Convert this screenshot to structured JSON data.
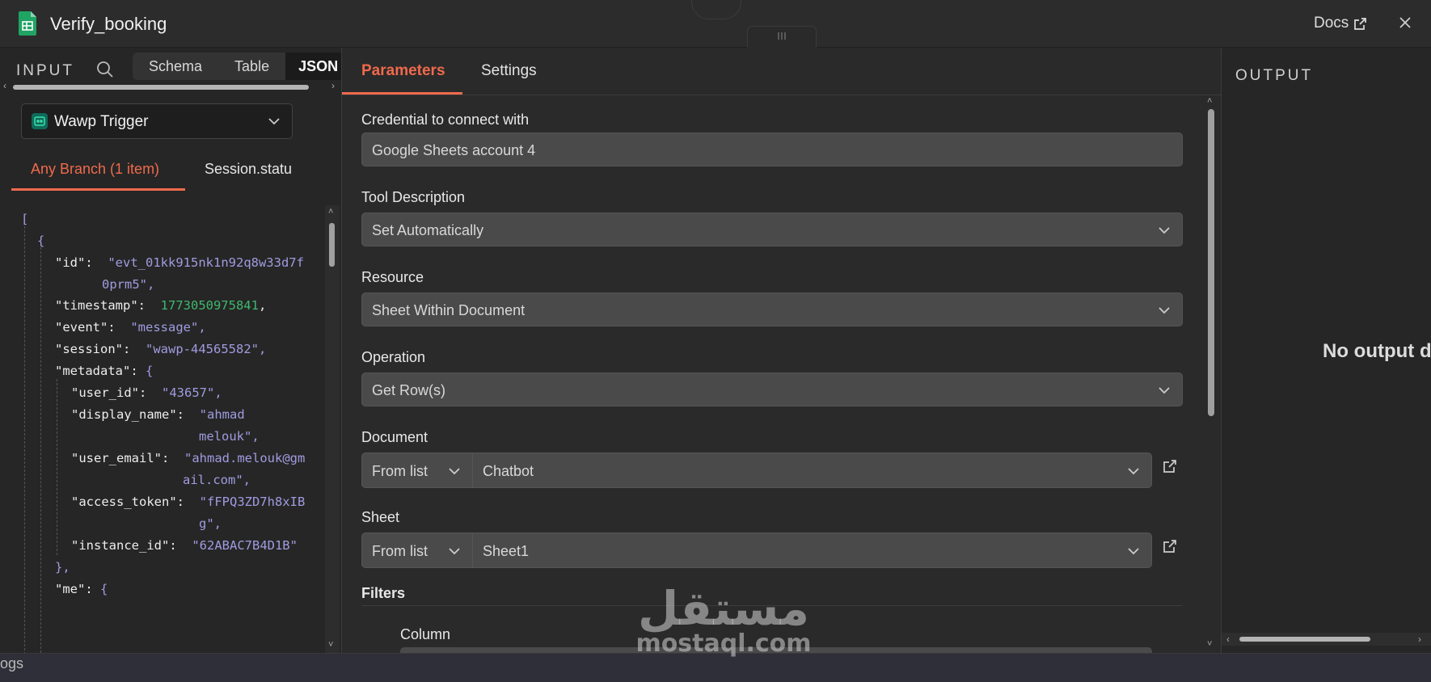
{
  "header": {
    "title": "Verify_booking",
    "docs_label": "Docs",
    "icons": {
      "sheet": "google-sheets-icon",
      "external": "external-link-icon",
      "close": "close-icon"
    }
  },
  "input_panel": {
    "label": "INPUT",
    "tabs": [
      {
        "label": "Schema",
        "active": false
      },
      {
        "label": "Table",
        "active": false
      },
      {
        "label": "JSON",
        "active": true
      }
    ],
    "node_selector": "Wawp Trigger",
    "branch_tabs": [
      {
        "label": "Any Branch (1 item)",
        "active": true
      },
      {
        "label": "Session.statu",
        "active": false
      }
    ],
    "json_lines": [
      {
        "key": "",
        "value": "["
      },
      {
        "key": "",
        "value": "{"
      },
      {
        "key": "\"id\":",
        "value": "\"evt_01kk915nk1n92q8w33d7f"
      },
      {
        "key": "",
        "value": "0prm5\","
      },
      {
        "key": "\"timestamp\":",
        "value": "1773050975841"
      },
      {
        "key": "\"event\":",
        "value": "\"message\","
      },
      {
        "key": "\"session\":",
        "value": "\"wawp-44565582\","
      },
      {
        "key": "\"metadata\":",
        "value": "{"
      },
      {
        "key": "\"user_id\":",
        "value": "\"43657\","
      },
      {
        "key": "\"display_name\":",
        "value": "\"ahmad"
      },
      {
        "key": "",
        "value": "melouk\","
      },
      {
        "key": "\"user_email\":",
        "value": "\"ahmad.melouk@gm"
      },
      {
        "key": "",
        "value": "ail.com\","
      },
      {
        "key": "\"access_token\":",
        "value": "\"fFPQ3ZD7h8xIB"
      },
      {
        "key": "",
        "value": "g\","
      },
      {
        "key": "\"instance_id\":",
        "value": "\"62ABAC7B4D1B\""
      },
      {
        "key": "",
        "value": "},"
      },
      {
        "key": "\"me\":",
        "value": "{"
      }
    ]
  },
  "parameters_panel": {
    "tabs": [
      {
        "label": "Parameters",
        "active": true
      },
      {
        "label": "Settings",
        "active": false
      }
    ],
    "fields": {
      "credential": {
        "label": "Credential to connect with",
        "value": "Google Sheets account 4"
      },
      "tool_description": {
        "label": "Tool Description",
        "value": "Set Automatically"
      },
      "resource": {
        "label": "Resource",
        "value": "Sheet Within Document"
      },
      "operation": {
        "label": "Operation",
        "value": "Get Row(s)"
      },
      "document": {
        "label": "Document",
        "mode": "From list",
        "value": "Chatbot"
      },
      "sheet": {
        "label": "Sheet",
        "mode": "From list",
        "value": "Sheet1"
      }
    },
    "filters_label": "Filters",
    "column_label": "Column"
  },
  "output_panel": {
    "label": "OUTPUT",
    "empty_text": "No output d"
  },
  "footer": {
    "logs_label": "ogs"
  },
  "watermark": {
    "arabic": "مستقل",
    "latin": "mostaql.com"
  },
  "colors": {
    "accent": "#ef6a4c",
    "json_string": "#a09be0",
    "json_number": "#3eb86d",
    "sheets_green": "#1fa463"
  }
}
